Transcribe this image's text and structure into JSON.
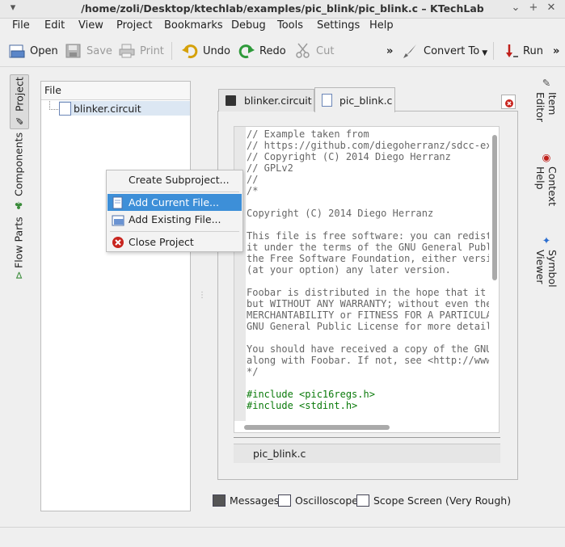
{
  "window": {
    "title": "/home/zoli/Desktop/ktechlab/examples/pic_blink/pic_blink.c – KTechLab"
  },
  "menubar": {
    "items": [
      "File",
      "Edit",
      "View",
      "Project",
      "Bookmarks",
      "Debug",
      "Tools",
      "Settings",
      "Help"
    ]
  },
  "toolbar": {
    "open": "Open",
    "save": "Save",
    "print": "Print",
    "undo": "Undo",
    "redo": "Redo",
    "cut": "Cut",
    "convert_to": "Convert To",
    "run": "Run",
    "overflow": "»"
  },
  "left_dock": {
    "tabs": [
      "Project",
      "Components",
      "Flow Parts"
    ]
  },
  "project_panel": {
    "header": "File",
    "items": [
      "blinker.circuit"
    ]
  },
  "context_menu": {
    "items": [
      "Create Subproject...",
      "Add Current File...",
      "Add Existing File...",
      "Close Project"
    ],
    "highlighted": "Add Current File..."
  },
  "editor": {
    "tabs": [
      "blinker.circuit",
      "pic_blink.c"
    ],
    "active_tab": "pic_blink.c",
    "code_lines": [
      "// Example taken from",
      "// https://github.com/diegoherranz/sdcc-ex",
      "// Copyright (C) 2014 Diego Herranz",
      "// GPLv2",
      "//",
      "/*",
      "",
      "Copyright (C) 2014 Diego Herranz",
      "",
      "This file is free software: you can redist",
      "it under the terms of the GNU General Publ",
      "the Free Software Foundation, either versi",
      "(at your option) any later version.",
      "",
      "Foobar is distributed in the hope that it",
      "but WITHOUT ANY WARRANTY; without even the",
      "MERCHANTABILITY or FITNESS FOR A PARTICULA",
      "GNU General Public License for more detail",
      "",
      "You should have received a copy of the GNU",
      "along with Foobar. If not, see <http://www",
      "*/",
      "",
      "#include <pic16regs.h>",
      "#include <stdint.h>"
    ],
    "file_label": "pic_blink.c"
  },
  "bottom_tabs": [
    "Messages",
    "Oscilloscope",
    "Scope Screen (Very Rough)"
  ],
  "right_dock": {
    "tabs": [
      "Item Editor",
      "Context Help",
      "Symbol Viewer"
    ]
  },
  "colors": {
    "highlight": "#3d8fd8",
    "include_green": "#0a7a0a"
  }
}
